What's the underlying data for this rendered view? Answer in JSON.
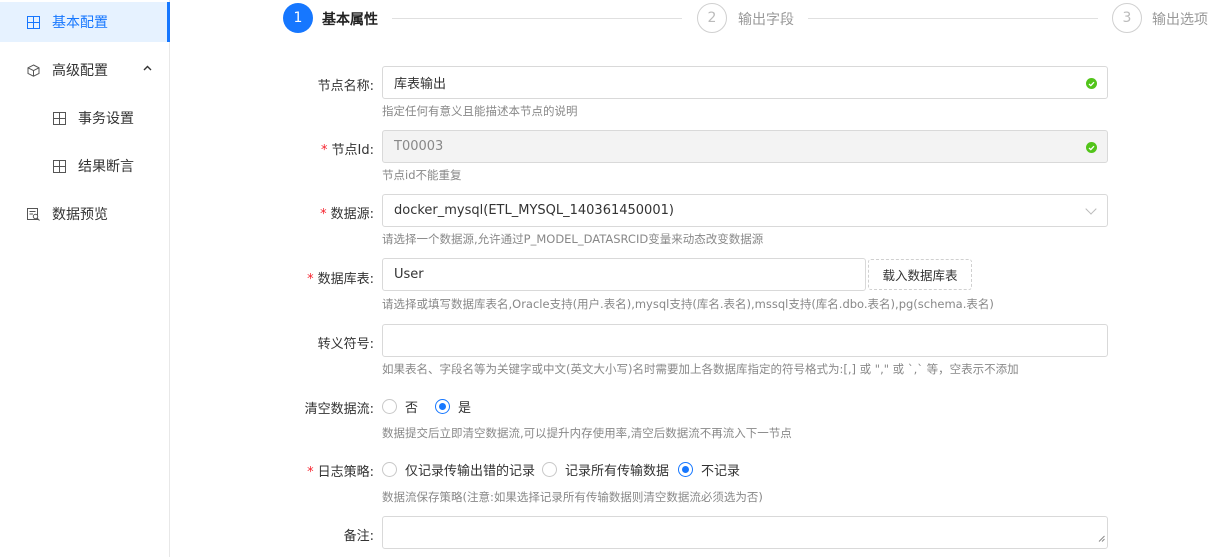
{
  "sidebar": {
    "items": [
      {
        "label": "基本配置",
        "icon": "grid-icon"
      },
      {
        "label": "高级配置",
        "icon": "cube-icon"
      },
      {
        "label": "事务设置",
        "icon": "grid-icon"
      },
      {
        "label": "结果断言",
        "icon": "grid-icon"
      },
      {
        "label": "数据预览",
        "icon": "preview-icon"
      }
    ]
  },
  "steps": [
    {
      "num": "1",
      "title": "基本属性",
      "state": "active"
    },
    {
      "num": "2",
      "title": "输出字段",
      "state": "todo"
    },
    {
      "num": "3",
      "title": "输出选项",
      "state": "todo"
    }
  ],
  "form": {
    "node_name": {
      "label": "节点名称:",
      "value": "库表输出",
      "hint": "指定任何有意义且能描述本节点的说明"
    },
    "node_id": {
      "label": "节点Id:",
      "value": "T00003",
      "hint": "节点id不能重复"
    },
    "datasource": {
      "label": "数据源:",
      "value": "docker_mysql(ETL_MYSQL_140361450001)",
      "hint": "请选择一个数据源,允许通过P_MODEL_DATASRCID变量来动态改变数据源"
    },
    "db_table": {
      "label": "数据库表:",
      "value": "User",
      "button": "载入数据库表",
      "hint": "请选择或填写数据库表名,Oracle支持(用户.表名),mysql支持(库名.表名),mssql支持(库名.dbo.表名),pg(schema.表名)"
    },
    "escape": {
      "label": "转义符号:",
      "value": "",
      "hint": "如果表名、字段名等为关键字或中文(英文大小写)名时需要加上各数据库指定的符号格式为:[,] 或 \",\" 或 `,` 等，空表示不添加"
    },
    "clear_stream": {
      "label": "清空数据流:",
      "opt_no": "否",
      "opt_yes": "是",
      "selected": "是",
      "hint": "数据提交后立即清空数据流,可以提升内存使用率,清空后数据流不再流入下一节点"
    },
    "log_policy": {
      "label": "日志策略:",
      "opt1": "仅记录传输出错的记录",
      "opt2": "记录所有传输数据",
      "opt3": "不记录",
      "selected": "不记录",
      "hint": "数据流保存策略(注意:如果选择记录所有传输数据则清空数据流必须选为否)"
    },
    "remark": {
      "label": "备注:",
      "value": ""
    },
    "required_mark": "*"
  },
  "colors": {
    "accent": "#1677ff",
    "success": "#52c41a",
    "required": "#f5222d"
  }
}
